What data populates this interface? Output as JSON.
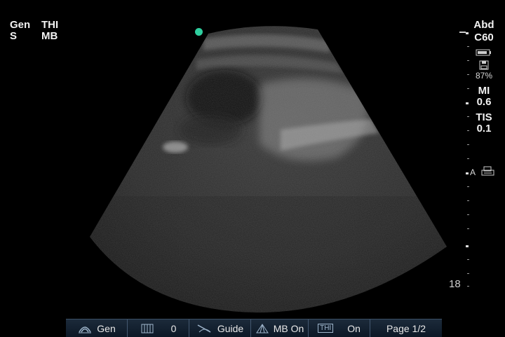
{
  "top_left": {
    "line1_a": "Gen",
    "line1_b": "THI",
    "line2_a": "S",
    "line2_b": "MB"
  },
  "right_panel": {
    "exam": "Abd",
    "transducer": "C60",
    "battery_pct": "87%",
    "mi_label": "MI",
    "mi_value": "0.6",
    "tis_label": "TIS",
    "tis_value": "0.1",
    "annot_label": "A",
    "depth": "18"
  },
  "bottom_bar": {
    "gain_label": "Gen",
    "dynamic_value": "0",
    "guide_label": "Guide",
    "mb_label": "MB On",
    "thi_icon_text": "THI",
    "thi_value": "On",
    "page_label": "Page 1/2"
  },
  "colors": {
    "marker": "#2fcf9f",
    "bar_bg": "#142232",
    "bar_border": "#445870"
  },
  "icons": [
    "orientation-marker",
    "battery-icon",
    "save-icon",
    "print-icon",
    "gain-icon",
    "dynamic-range-icon",
    "needle-guide-icon",
    "mb-icon"
  ]
}
